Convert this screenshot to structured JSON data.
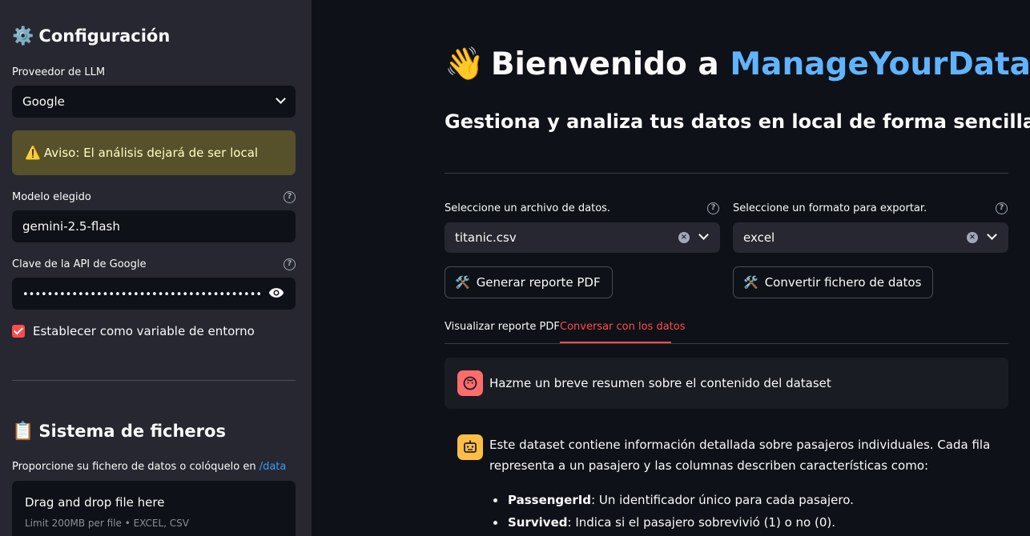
{
  "sidebar": {
    "config_title": "Configuración",
    "config_icon": "gear-icon",
    "provider_label": "Proveedor de LLM",
    "provider_value": "Google",
    "warning_text": "Aviso: El análisis dejará de ser local",
    "warning_icon": "warning-icon",
    "model_label": "Modelo elegido",
    "model_value": "gemini-2.5-flash",
    "api_key_label": "Clave de la API de Google",
    "api_key_value": "•••••••••••••••••••••••••••••••••••••••",
    "env_checkbox_label": "Establecer como variable de entorno",
    "env_checkbox_checked": true,
    "files_title": "Sistema de ficheros",
    "files_icon": "clipboard-icon",
    "files_caption": "Proporcione su fichero de datos o colóquelo en ",
    "files_caption_link": "/data",
    "dropzone_title": "Drag and drop file here",
    "dropzone_sub": "Limit 200MB per file • EXCEL, CSV"
  },
  "main": {
    "title_prefix": "Bienvenido a ",
    "title_accent": "ManageYourData",
    "title_icon": "waving-hand-icon",
    "subtitle": "Gestiona y analiza tus datos en local de forma sencilla.",
    "data_file_label": "Seleccione un archivo de datos.",
    "data_file_value": "titanic.csv",
    "export_label": "Seleccione un formato para exportar.",
    "export_value": "excel",
    "report_button": "Generar reporte PDF",
    "convert_button": "Convertir fichero de datos",
    "tabs": [
      {
        "label": "Visualizar reporte PDF",
        "active": false
      },
      {
        "label": "Conversar con los datos",
        "active": true
      }
    ],
    "user_message": "Hazme un breve resumen sobre el contenido del dataset",
    "bot_message": "Este dataset contiene información detallada sobre pasajeros individuales. Cada fila representa a un pasajero y las columnas describen características como:",
    "bullets": [
      {
        "term": "PassengerId",
        "desc": ": Un identificador único para cada pasajero."
      },
      {
        "term": "Survived",
        "desc": ": Indica si el pasajero sobrevivió (1) o no (0)."
      }
    ]
  },
  "colors": {
    "accent": "#ff4b4b",
    "title_accent": "#60b4ff",
    "sidebar_bg": "#262730",
    "main_bg": "#0e1117"
  }
}
